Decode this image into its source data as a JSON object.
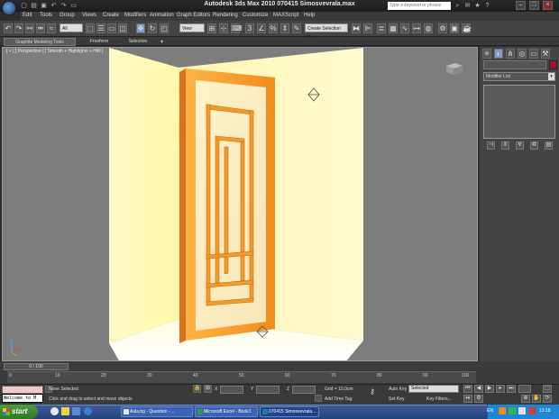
{
  "window": {
    "title": "Autodesk 3ds Max  2010       070415 Simosvevrala.max",
    "search_placeholder": "Type a keyword or phrase"
  },
  "menu": {
    "items": [
      "Edit",
      "Tools",
      "Group",
      "Views",
      "Create",
      "Modifiers",
      "Animation",
      "Graph Editors",
      "Rendering",
      "Customize",
      "MAXScript",
      "Help"
    ]
  },
  "toolbar": {
    "selection_filter": "All",
    "reference_coord": "View",
    "named_selection": "Create Selection Se"
  },
  "ribbon": {
    "tabs": [
      "Graphite Modeling Tools",
      "Freeform",
      "Selection"
    ]
  },
  "viewport": {
    "label": "[ + ] [ Perspective ] [ Smooth + Highlights + HW ]"
  },
  "command_panel": {
    "modifier_list": "Modifier List",
    "object_color": "#9a1530"
  },
  "timeline": {
    "slider": "0 / 100",
    "ticks": [
      "0",
      "10",
      "20",
      "30",
      "40",
      "50",
      "60",
      "70",
      "80",
      "90",
      "100"
    ]
  },
  "status": {
    "maxscript": "Welcome to M",
    "selection": "None Selected",
    "prompt": "Click and drag to select and move objects",
    "x_label": "X",
    "y_label": "Y",
    "z_label": "Z",
    "grid": "Grid = 10,0cm",
    "add_time_tag": "Add Time Tag",
    "auto_key": "Auto Key",
    "selected": "Selected",
    "set_key": "Set Key",
    "key_filters": "Key Filters..."
  },
  "taskbar": {
    "start": "start",
    "tasks": [
      "Aula.bg - Question - ...",
      "Microsoft Excel - Book1",
      "070415 Simosvevrala..."
    ],
    "lang": "EN",
    "clock": "13:18"
  }
}
